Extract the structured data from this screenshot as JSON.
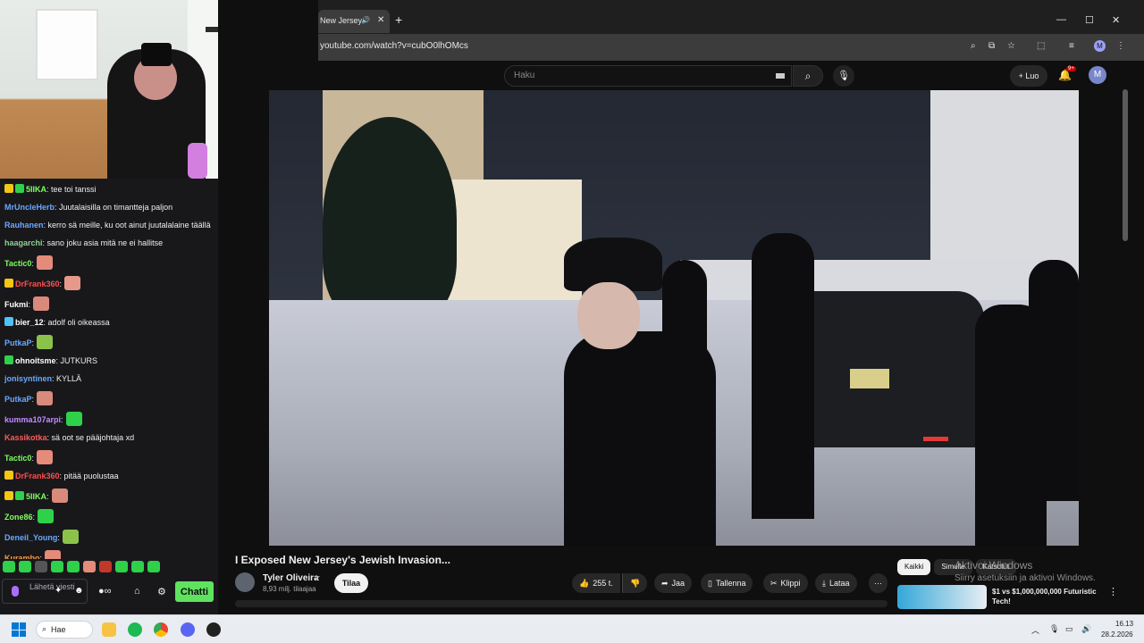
{
  "colors": {
    "chat_bg": "#18181b",
    "accent_green": "#5fe35f",
    "twitch_purple": "#a970ff",
    "yt_bg": "#0f0f0f",
    "taskbar": "#e9edf1"
  },
  "chat": {
    "messages": [
      {
        "user": "5IIKA",
        "color": "#7fff5f",
        "badges": [
          "crown",
          "green"
        ],
        "text": ": tee toi tanssi",
        "emote": false
      },
      {
        "user": "MrUncleHerb",
        "color": "#6aa8ff",
        "badges": [],
        "text": ": Juutalaisilla on timantteja paljon",
        "emote": false
      },
      {
        "user": "Rauhanen",
        "color": "#6aa8ff",
        "badges": [],
        "text": ": kerro sä meille, ku oot ainut juutalalaine täällä",
        "emote": false
      },
      {
        "user": "haagarchi",
        "color": "#8fd18f",
        "badges": [],
        "text": ": sano joku asia mitä ne ei hallitse",
        "emote": false
      },
      {
        "user": "Tactic0",
        "color": "#7fff5f",
        "badges": [],
        "text": ":",
        "emote": true
      },
      {
        "user": "DrFrank360",
        "color": "#ff4d4d",
        "badges": [
          "crown"
        ],
        "text": ":",
        "emote": true
      },
      {
        "user": "Fukmi",
        "color": "#ffffff",
        "badges": [],
        "text": ":",
        "emote": true
      },
      {
        "user": "bier_12",
        "color": "#ffffff",
        "badges": [
          "bottle"
        ],
        "text": ": adolf oli oikeassa",
        "emote": false
      },
      {
        "user": "PutkaP",
        "color": "#6aa8ff",
        "badges": [],
        "text": ":",
        "emote": true
      },
      {
        "user": "ohnoitsme",
        "color": "#ffffff",
        "badges": [
          "green"
        ],
        "text": ": JUTKURS",
        "emote": false
      },
      {
        "user": "jonisyntinen",
        "color": "#6aa8ff",
        "badges": [],
        "text": ": KYLLÄ",
        "emote": false
      },
      {
        "user": "PutkaP",
        "color": "#6aa8ff",
        "badges": [],
        "text": ":",
        "emote": true
      },
      {
        "user": "kumma107arpi",
        "color": "#c48bff",
        "badges": [],
        "text": ":",
        "emote": true
      },
      {
        "user": "Kassikotka",
        "color": "#ff5a5a",
        "badges": [],
        "text": ": sä oot se pääjohtaja xd",
        "emote": false
      },
      {
        "user": "Tactic0",
        "color": "#7fff5f",
        "badges": [],
        "text": ":",
        "emote": true
      },
      {
        "user": "DrFrank360",
        "color": "#ff4d4d",
        "badges": [
          "crown"
        ],
        "text": ": pitää puolustaa",
        "emote": false
      },
      {
        "user": "5IIKA",
        "color": "#7fff5f",
        "badges": [
          "crown",
          "green"
        ],
        "text": ":",
        "emote": true
      },
      {
        "user": "Zone86",
        "color": "#7fff5f",
        "badges": [],
        "text": ":",
        "emote": true
      },
      {
        "user": "Deneil_Young",
        "color": "#6aa8ff",
        "badges": [],
        "text": ":",
        "emote": true
      },
      {
        "user": "Kurambo",
        "color": "#ff9a3c",
        "badges": [],
        "text": ":",
        "emote": true
      }
    ],
    "input_placeholder": "Lähetä viesti",
    "send_label": "Chatti"
  },
  "browser": {
    "tab_title": "New Jersey",
    "url": "youtube.com/watch?v=cubO0lhOMcs",
    "profile_initial": "M"
  },
  "youtube": {
    "search_placeholder": "Haku",
    "create_label": "Luo",
    "notif_count": "9+",
    "avatar_initial": "M",
    "video_title": "I Exposed New Jersey's Jewish Invasion...",
    "channel_name": "Tyler Oliveira",
    "subscribers": "8,93 milj. tilaajaa",
    "subscribe_label": "Tilaa",
    "likes": "255 t.",
    "share_label": "Jaa",
    "save_label": "Tallenna",
    "clip_label": "Klippi",
    "download_label": "Lataa",
    "chips": [
      "Kaikki",
      "Simulle",
      "Katsotut"
    ],
    "reco_title": "$1 vs $1,000,000,000 Futuristic Tech!"
  },
  "windows": {
    "activation_line1": "Aktivoi Windows",
    "activation_line2": "Siirry asetuksiin ja aktivoi Windows.",
    "search_label": "Hae",
    "time": "16.13",
    "date": "28.2.2026"
  }
}
